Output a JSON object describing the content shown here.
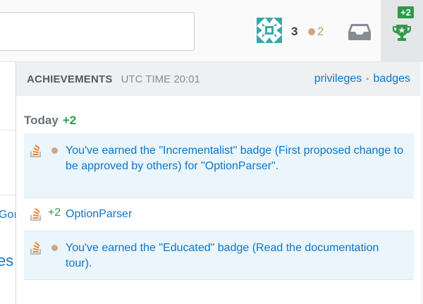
{
  "topbar": {
    "reputation": "3",
    "bronze_count": "2",
    "achievements_delta": "+2",
    "icons": {
      "avatar": "identicon-avatar",
      "inbox": "inbox-icon",
      "achievements": "trophy-icon"
    }
  },
  "background_fragments": {
    "left_text_1": "Goı",
    "left_text_2": "es"
  },
  "dropdown": {
    "title": "ACHIEVEMENTS",
    "time": "UTC TIME 20:01",
    "link_privileges": "privileges",
    "separator": "•",
    "link_badges": "badges",
    "day_label": "Today",
    "day_delta": "+2",
    "items": [
      {
        "type": "badge",
        "text": "You've earned the \"Incrementalist\" badge (First proposed change to be approved by others) for \"OptionParser\".",
        "icon": "stackoverflow-icon",
        "highlighted": true
      },
      {
        "type": "rep",
        "delta": "+2",
        "text": "OptionParser",
        "icon": "stackoverflow-icon",
        "highlighted": false
      },
      {
        "type": "badge",
        "text": "You've earned the \"Educated\" badge (Read the documentation tour).",
        "icon": "stackoverflow-icon",
        "highlighted": true
      }
    ]
  },
  "colors": {
    "link": "#0c76c8",
    "green": "#2e9a4b",
    "bronze": "#d1a684",
    "highlight": "#eaf5fc"
  }
}
